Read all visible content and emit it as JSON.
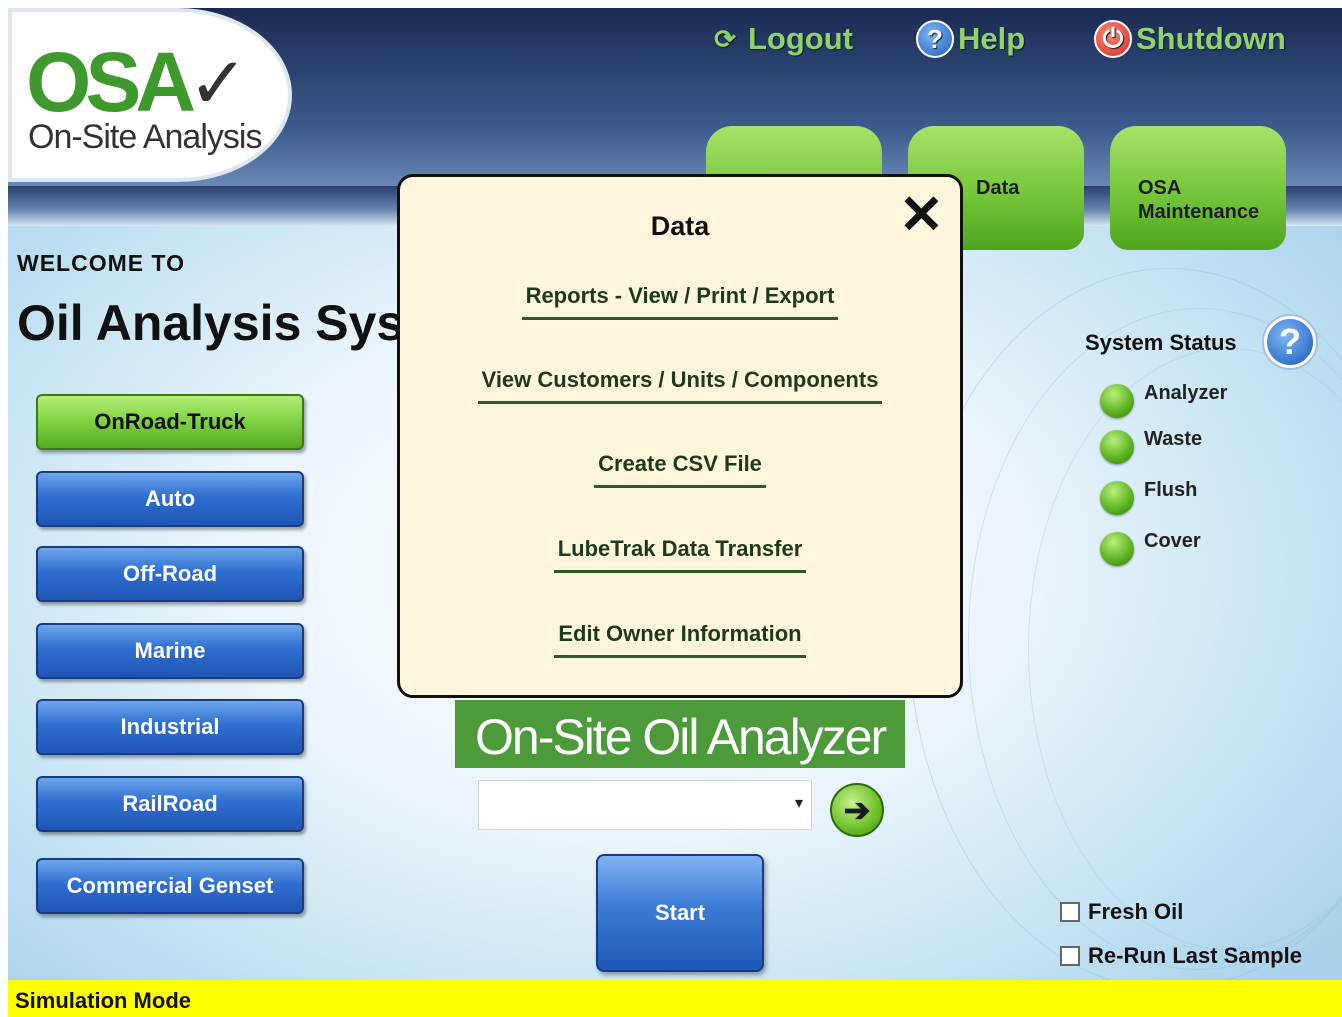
{
  "header": {
    "logo_mark": "OSA",
    "logo_text": "On-Site Analysis",
    "logout_label": "Logout",
    "help_label": "Help",
    "shutdown_label": "Shutdown",
    "tabs": [
      {
        "label": ""
      },
      {
        "label": "Data"
      },
      {
        "label": "OSA Maintenance"
      }
    ]
  },
  "welcome": {
    "small": "WELCOME TO",
    "title": "Oil Analysis System"
  },
  "nav": {
    "items": [
      {
        "label": "OnRoad-Truck",
        "active": true
      },
      {
        "label": "Auto",
        "active": false
      },
      {
        "label": "Off-Road",
        "active": false
      },
      {
        "label": "Marine",
        "active": false
      },
      {
        "label": "Industrial",
        "active": false
      },
      {
        "label": "RailRoad",
        "active": false
      },
      {
        "label": "Commercial Genset",
        "active": false
      }
    ]
  },
  "system_status": {
    "title": "System Status",
    "help_glyph": "?",
    "items": [
      {
        "label": "Analyzer",
        "status": "ok"
      },
      {
        "label": "Waste",
        "status": "ok"
      },
      {
        "label": "Flush",
        "status": "ok"
      },
      {
        "label": "Cover",
        "status": "ok"
      }
    ]
  },
  "center": {
    "brand_text": "On-Site Oil Analyzer",
    "select_value": "",
    "start_label": "Start"
  },
  "options": {
    "fresh_oil_label": "Fresh Oil",
    "fresh_oil_checked": false,
    "rerun_label": "Re-Run Last Sample",
    "rerun_checked": false
  },
  "footer": {
    "mode_text": "Simulation Mode"
  },
  "modal": {
    "title": "Data",
    "close_glyph": "✕",
    "links": [
      {
        "label": "Reports - View / Print / Export"
      },
      {
        "label": "View Customers / Units / Components"
      },
      {
        "label": "Create CSV File"
      },
      {
        "label": "LubeTrak Data Transfer"
      },
      {
        "label": "Edit Owner Information"
      }
    ]
  },
  "colors": {
    "accent_green": "#74c63a",
    "nav_blue": "#2f6fd0",
    "footer_yellow": "#ffff00",
    "modal_bg": "#fdf5dc"
  }
}
